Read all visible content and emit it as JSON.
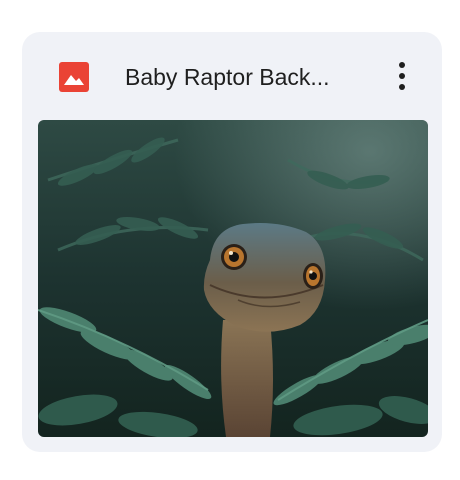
{
  "card": {
    "title": "Baby Raptor Back...",
    "file_icon": "image-file-icon",
    "menu_icon": "more-vert-icon",
    "thumbnail_icon": "baby-raptor-in-ferns-image"
  },
  "colors": {
    "card_background": "#f0f2f7",
    "file_icon": "#ea4335",
    "title_text": "#1f1f1f",
    "menu_icon": "#1f1f1f"
  }
}
